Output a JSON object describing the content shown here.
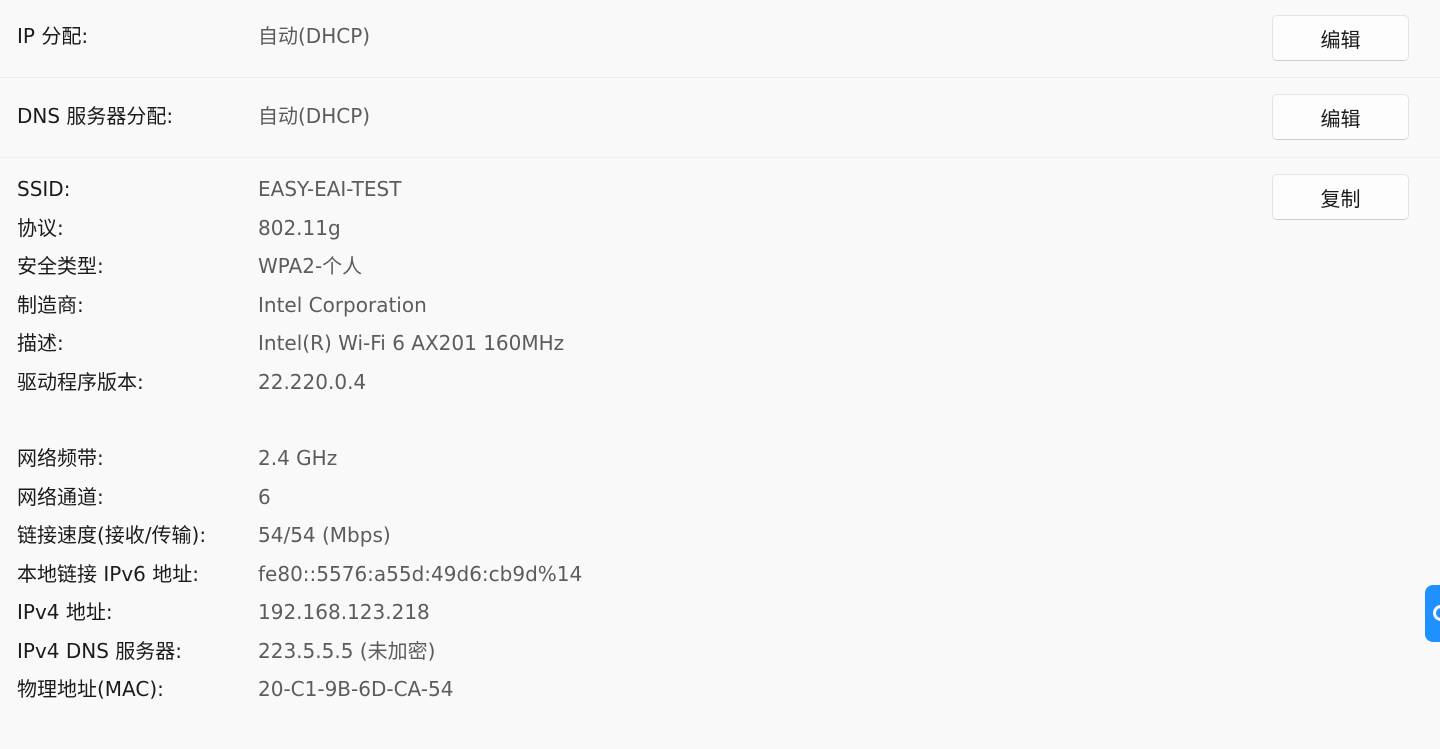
{
  "ip_assignment": {
    "label": "IP 分配:",
    "value": "自动(DHCP)",
    "button": "编辑"
  },
  "dns_assignment": {
    "label": "DNS 服务器分配:",
    "value": "自动(DHCP)",
    "button": "编辑"
  },
  "copy_button": "复制",
  "properties": [
    {
      "label": "SSID:",
      "value": "EASY-EAI-TEST"
    },
    {
      "label": "协议:",
      "value": "802.11g"
    },
    {
      "label": "安全类型:",
      "value": "WPA2-个人"
    },
    {
      "label": "制造商:",
      "value": "Intel Corporation"
    },
    {
      "label": "描述:",
      "value": "Intel(R) Wi-Fi 6 AX201 160MHz"
    },
    {
      "label": "驱动程序版本:",
      "value": "22.220.0.4"
    },
    {
      "label": "网络频带:",
      "value": "2.4 GHz"
    },
    {
      "label": "网络通道:",
      "value": "6"
    },
    {
      "label": "链接速度(接收/传输):",
      "value": "54/54 (Mbps)"
    },
    {
      "label": "本地链接 IPv6 地址:",
      "value": "fe80::5576:a55d:49d6:cb9d%14"
    },
    {
      "label": "IPv4 地址:",
      "value": "192.168.123.218"
    },
    {
      "label": "IPv4 DNS 服务器:",
      "value": "223.5.5.5 (未加密)"
    },
    {
      "label": "物理地址(MAC):",
      "value": "20-C1-9B-6D-CA-54"
    }
  ],
  "colors": {
    "accent": "#1e90ff",
    "label": "#1b1b1b",
    "value": "#5c5c5c",
    "background": "#f9f9f9"
  }
}
